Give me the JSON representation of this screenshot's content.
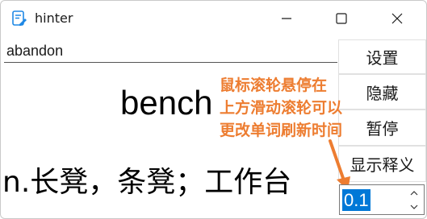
{
  "window": {
    "title": "hinter"
  },
  "input": {
    "value": "abandon"
  },
  "buttons": {
    "settings": "设置",
    "hide": "隐藏",
    "pause": "暂停",
    "show_meaning": "显示释义"
  },
  "display": {
    "word": "bench",
    "meaning": "n.长凳，条凳；工作台"
  },
  "spinbox": {
    "value": "0.1"
  },
  "annotation": {
    "lines": [
      "鼠标滚轮悬停在",
      "上方滑动滚轮可以",
      "更改单词刷新时间"
    ]
  },
  "colors": {
    "annotation": "#ed7d31",
    "selection": "#0078d7"
  },
  "icons": {
    "app": "notepad-pen-icon",
    "minimize": "minimize-icon",
    "maximize": "maximize-icon",
    "close": "close-icon"
  }
}
